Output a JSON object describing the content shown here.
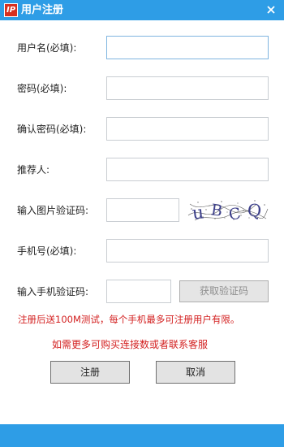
{
  "window": {
    "title": "用户注册",
    "app_icon_text": "IP",
    "close_icon": "close-icon"
  },
  "form": {
    "username_label": "用户名(必填):",
    "password_label": "密码(必填):",
    "confirm_password_label": "确认密码(必填):",
    "referrer_label": "推荐人:",
    "captcha_label": "输入图片验证码:",
    "phone_label": "手机号(必填):",
    "sms_code_label": "输入手机验证码:",
    "username_value": "",
    "password_value": "",
    "confirm_password_value": "",
    "referrer_value": "",
    "captcha_value": "",
    "phone_value": "",
    "sms_code_value": ""
  },
  "captcha_image": {
    "text": "uBCQ"
  },
  "buttons": {
    "get_sms_code": "获取验证码",
    "register": "注册",
    "cancel": "取消"
  },
  "notices": {
    "line1": "注册后送100M测试，每个手机最多可注册用户有限。",
    "line2": "如需更多可购买连接数或者联系客服"
  },
  "colors": {
    "titlebar": "#2e9de6",
    "notice_text": "#d32020",
    "icon_red": "#d8301f"
  }
}
